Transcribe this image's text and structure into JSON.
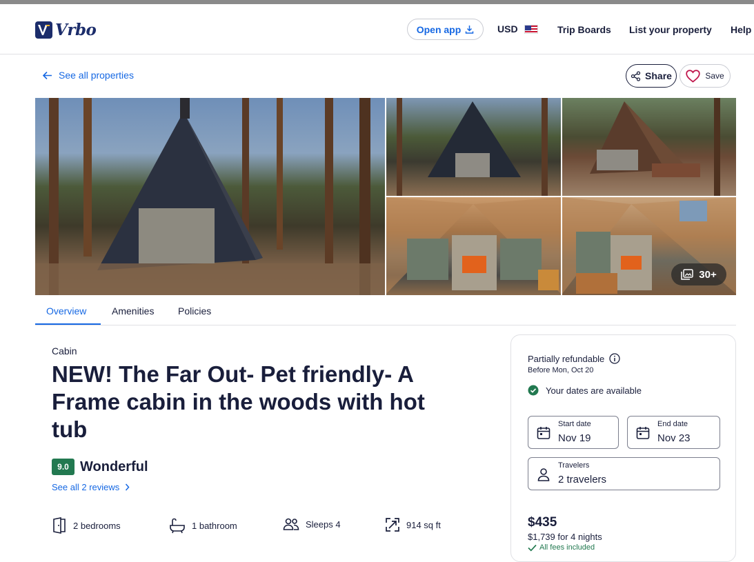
{
  "header": {
    "brand": "Vrbo",
    "open_app": "Open app",
    "currency": "USD",
    "trip_boards": "Trip Boards",
    "list_property": "List your property",
    "help": "Help"
  },
  "toolbar": {
    "back_label": "See all properties",
    "share_label": "Share",
    "save_label": "Save"
  },
  "gallery": {
    "more_count": "30+"
  },
  "tabs": [
    {
      "label": "Overview",
      "active": true
    },
    {
      "label": "Amenities",
      "active": false
    },
    {
      "label": "Policies",
      "active": false
    }
  ],
  "property": {
    "type": "Cabin",
    "title": "NEW! The Far Out- Pet friendly- A Frame cabin in the woods with hot tub",
    "rating_score": "9.0",
    "rating_word": "Wonderful",
    "reviews_link": "See all 2 reviews",
    "facts": {
      "bedrooms": "2 bedrooms",
      "bathrooms": "1 bathroom",
      "sleeps": "Sleeps 4",
      "area": "914 sq ft"
    }
  },
  "booking": {
    "refund_title": "Partially refundable",
    "refund_sub": "Before Mon, Oct 20",
    "availability": "Your dates are available",
    "start_label": "Start date",
    "start_value": "Nov 19",
    "end_label": "End date",
    "end_value": "Nov 23",
    "travelers_label": "Travelers",
    "travelers_value": "2 travelers",
    "nightly_price": "$435",
    "total": "$1,739 for 4 nights",
    "fees": "All fees included"
  },
  "colors": {
    "accent": "#1668e3",
    "brand": "#1c2d6b",
    "rating": "#227950",
    "text": "#191e3b"
  }
}
